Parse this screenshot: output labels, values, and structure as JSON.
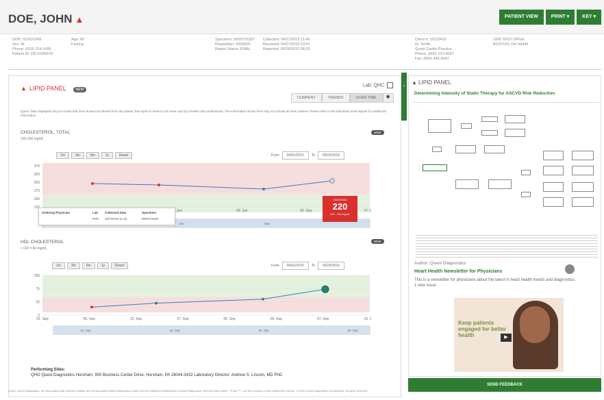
{
  "header": {
    "patient_name": "DOE, JOHN",
    "buttons": [
      "PATIENT VIEW",
      "PRINT ▾",
      "KEY ▾"
    ]
  },
  "demographics": {
    "col1": [
      "DOB: 01/01/1945",
      "Sex: M",
      "Phone: (610) 224-1495",
      "Patient ID: PE12345678"
    ],
    "col2": [
      "Age: 69",
      "Fasting"
    ],
    "col3": [
      "Specimen: 9000715257",
      "Requisition: 9000626",
      "Report Status: FINAL"
    ],
    "col4": [
      "Collected: 04/27/2015 11:40",
      "Received: 04/27/2015 23:41",
      "Reported: 05/28/2015 08:20"
    ],
    "col5": [
      "Client #: 10115432",
      "Dr. Smith",
      "Quest Cardio Practice",
      "Phone: (800) 123-4567",
      "Fax: (800) 445-4567"
    ],
    "col6": [
      "1000 TEST DRIVE",
      "BOSTON, OH 44444"
    ]
  },
  "lipid_panel": {
    "title": "LIPID PANEL",
    "badge": "NEW",
    "lab_label": "Lab: QHC",
    "tabs": [
      "CURRENT",
      "TRENDS",
      "OVER TIME"
    ],
    "disclaimer": "Quest: Data displayed only for results that were drawn in/collected from the patient; this report is meant to be used only by a health care professional. The information shown here may not include all tests ordered. Please refer to the individual result reports for additional information."
  },
  "chart1": {
    "label": "CHOLESTEROL, TOTAL",
    "units": "125-200 mg/dL",
    "badge": "NEW",
    "range_buttons": [
      "1m",
      "3m",
      "6m",
      "1y",
      "Reset"
    ],
    "from_label": "From",
    "from_value": "06/01/2015",
    "to_label": "To",
    "to_value": "05/29/2016",
    "y_ticks": [
      "275",
      "225",
      "200",
      "175",
      "150",
      "125"
    ],
    "x_ticks": [
      "1 Jun",
      "29. Jun",
      "26. Sep",
      "27. Dec"
    ],
    "navigator_ticks": [
      "Jun",
      "Sep"
    ],
    "tooltip": {
      "headers": [
        "Ordering Physician",
        "Lab",
        "Collected Date",
        "Specimen"
      ],
      "values": [
        "",
        "PHP",
        "4/27/2015 11:40",
        "9000715257"
      ]
    },
    "callout": {
      "top": "04/26/2016",
      "value": "220",
      "bottom": "125 - 200 mg/dL"
    }
  },
  "chart2": {
    "label": "HDL CHOLESTEROL",
    "units": "> OR = 40 mg/dL",
    "badge": "NEW",
    "range_buttons": [
      "1m",
      "3m",
      "6m",
      "1y",
      "Reset"
    ],
    "from_label": "From",
    "from_value": "06/01/2015",
    "to_label": "To",
    "to_value": "05/29/2016",
    "y_ticks": [
      "100",
      "75",
      "25",
      "0"
    ],
    "x_ticks": [
      "01. Sep",
      "05. Sep",
      "22. Sep",
      "27. Sep",
      "05. Sep",
      "05. Sep",
      "07. Sep",
      "19. Sep"
    ],
    "navigator_ticks": [
      "12. Sep",
      "19. Sep",
      "26. Sep",
      "28. Sep"
    ]
  },
  "performing": {
    "label": "Performing Sites:",
    "text": "QHO Quest Diagnostics Horsham, 900 Business Center Drive, Horsham, PA 19044-3432 Laboratory Director: Andrew S. Lincoln, MD PhD"
  },
  "footer_note": "Quest, Quest Diagnostics, the associated logo, Nichols Institute and all associated Quest Diagnostics marks are the registered trademarks of Quest Diagnostics. All third party marks - ® and ™ - are the property of their respective owners. © 2016 Quest Diagnostics Incorporated. All rights reserved.",
  "right_panel": {
    "title": "LIPID PANEL",
    "subtitle": "Determining Intensity of Statin Therapy for ASCVD Risk Reduction",
    "author": "Author: Quest Diagnostics",
    "newsletter_title": "Heart Health Newsletter for Physicians",
    "newsletter_desc": "This is a newsletter for physicians about the latest in heart health trends and diagnostics.",
    "newsletter_date": "1 new issue",
    "ad_text": "Keep patients engaged for better health",
    "send_feedback": "SEND FEEDBACK"
  },
  "colors": {
    "brand_green": "#2e7d32",
    "alert_red": "#d9302f",
    "series_line": "#3a7bbd"
  },
  "chart_data": [
    {
      "type": "line",
      "title": "CHOLESTEROL, TOTAL",
      "x": [
        "1 Jun",
        "29. Jun",
        "26. Sep",
        "27. Dec"
      ],
      "values": [
        210,
        205,
        190,
        220
      ],
      "ylim": [
        125,
        275
      ],
      "reference_range": [
        125,
        200
      ]
    },
    {
      "type": "line",
      "title": "HDL CHOLESTEROL",
      "x": [
        "05. Sep",
        "22. Sep",
        "05. Sep",
        "19. Sep"
      ],
      "values": [
        20,
        30,
        40,
        65
      ],
      "ylim": [
        0,
        100
      ],
      "reference_range": [
        40,
        100
      ]
    }
  ]
}
